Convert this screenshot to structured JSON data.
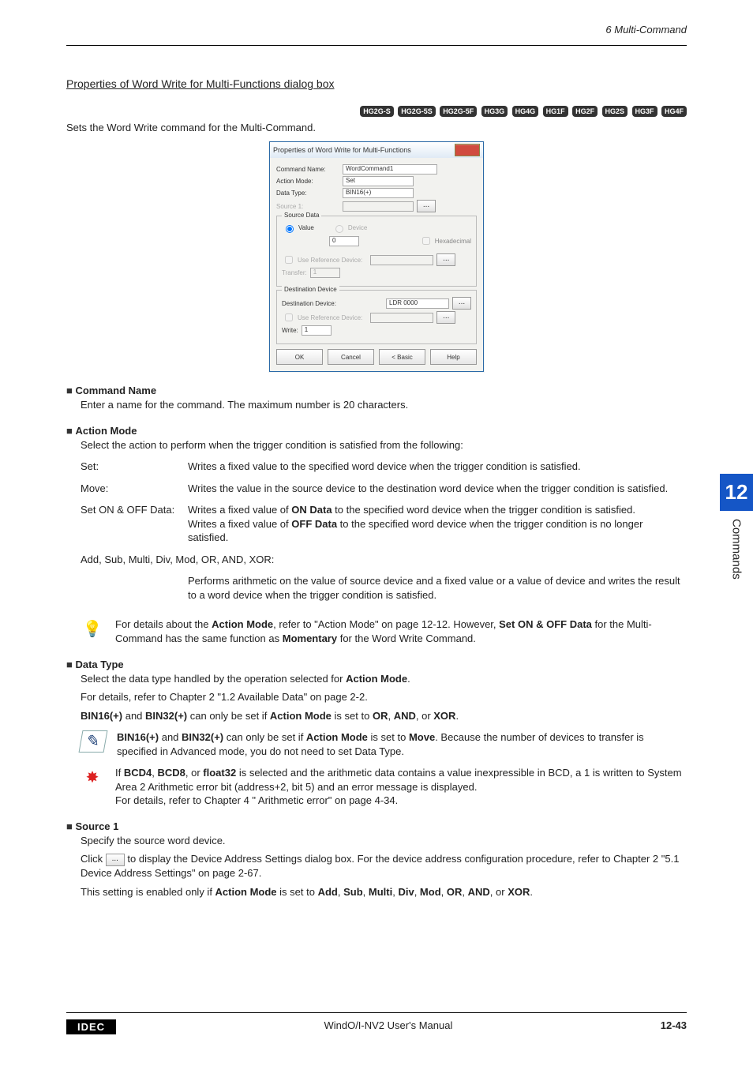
{
  "header": {
    "right": "6 Multi-Command"
  },
  "section_title": "Properties of Word Write for Multi-Functions dialog box",
  "pills": [
    "HG2G-S",
    "HG2G-5S",
    "HG2G-5F",
    "HG3G",
    "HG4G",
    "HG1F",
    "HG2F",
    "HG2S",
    "HG3F",
    "HG4F"
  ],
  "intro": "Sets the Word Write command for the Multi-Command.",
  "dlg": {
    "title": "Properties of Word Write for Multi-Functions",
    "close": "x",
    "fields": {
      "command_name_label": "Command Name:",
      "command_name_value": "WordCommand1",
      "action_mode_label": "Action Mode:",
      "action_mode_value": "Set",
      "data_type_label": "Data Type:",
      "data_type_value": "BIN16(+)",
      "source1_label": "Source 1:"
    },
    "src_group_title": "Source Data",
    "src": {
      "value_radio": "Value",
      "device_radio": "Device",
      "value": "0",
      "hex_label": "Hexadecimal",
      "use_ref_label": "Use Reference Device:",
      "transfer_label": "Transfer:",
      "transfer_value": "1"
    },
    "dst_group_title": "Destination Device",
    "dst": {
      "dest_label": "Destination Device:",
      "dest_value": "LDR 0000",
      "use_ref_label": "Use Reference Device:",
      "write_label": "Write:",
      "write_value": "1"
    },
    "buttons": {
      "ok": "OK",
      "cancel": "Cancel",
      "basic": "< Basic",
      "help": "Help"
    }
  },
  "cmdname_heading": "Command Name",
  "cmdname_body": "Enter a name for the command. The maximum number is 20 characters.",
  "actionmode_heading": "Action Mode",
  "actionmode_body": "Select the action to perform when the trigger condition is satisfied from the following:",
  "modes": {
    "set_k": "Set:",
    "set_v": "Writes a fixed value to the specified word device when the trigger condition is satisfied.",
    "move_k": "Move:",
    "move_v": "Writes the value in the source device to the destination word device when the trigger condition is satisfied.",
    "onoff_k": "Set ON & OFF Data:",
    "onoff_v1a": "Writes a fixed value of ",
    "onoff_v1b": "ON Data",
    "onoff_v1c": " to the specified word device when the trigger condition is satisfied.",
    "onoff_v2a": "Writes a fixed value of ",
    "onoff_v2b": "OFF Data",
    "onoff_v2c": " to the specified word device when the trigger condition is no longer satisfied.",
    "arith_k": "Add, Sub, Multi, Div, Mod, OR, AND, XOR:",
    "arith_v": "Performs arithmetic on the value of source device and a fixed value or a value of device and writes the result to a word device when the trigger condition is satisfied."
  },
  "bulb_note_a": "For details about the ",
  "bulb_note_b": "Action Mode",
  "bulb_note_c": ", refer to \"Action Mode\" on page 12-12. However, ",
  "bulb_note_d": "Set ON & OFF Data",
  "bulb_note_e": " for the Multi-Command has the same function as ",
  "bulb_note_f": "Momentary",
  "bulb_note_g": " for the Word Write Command.",
  "datatype_heading": "Data Type",
  "datatype_line1a": "Select the data type handled by the operation selected for ",
  "datatype_line1b": "Action Mode",
  "datatype_line1c": ".",
  "datatype_line2": "For details, refer to Chapter 2 \"1.2 Available Data\" on page 2-2.",
  "datatype_line3_parts": {
    "a": "BIN16(+)",
    "b": " and ",
    "c": "BIN32(+)",
    "d": " can only be set if ",
    "e": "Action Mode",
    "f": " is set to ",
    "g": "OR",
    "h": ", ",
    "i": "AND",
    "j": ", or ",
    "k": "XOR",
    "l": "."
  },
  "pencil_note": {
    "a": "BIN16(+)",
    "b": " and ",
    "c": "BIN32(+)",
    "d": " can only be set if ",
    "e": "Action Mode",
    "f": " is set to ",
    "g": "Move",
    "h": ". Because the number of devices to transfer is specified in Advanced mode, you do not need to set Data Type."
  },
  "warn_note": {
    "a": "If ",
    "b": "BCD4",
    "c": ", ",
    "d": "BCD8",
    "e": ", or ",
    "f": "float32",
    "g": " is selected and the arithmetic data contains a value inexpressible in BCD, a 1 is written to System Area 2 Arithmetic error bit (address+2, bit 5) and an error message is displayed.",
    "h": "For details, refer to Chapter 4 \" Arithmetic error\" on page 4-34."
  },
  "source1_heading": "Source 1",
  "source1_body": "Specify the source word device.",
  "source1_click_a": "Click ",
  "source1_click_btn": "...",
  "source1_click_b": " to display the Device Address Settings dialog box. For the device address configuration procedure, refer to Chapter 2 \"5.1 Device Address Settings\" on page 2-67.",
  "source1_enable": {
    "a": "This setting is enabled only if ",
    "b": "Action Mode",
    "c": " is set to ",
    "d": "Add",
    "e": ", ",
    "f": "Sub",
    "g": ", ",
    "h": "Multi",
    "i": ", ",
    "j": "Div",
    "k": ", ",
    "l": "Mod",
    "m": ", ",
    "n": "OR",
    "o": ", ",
    "p": "AND",
    "q": ", or ",
    "r": "XOR",
    "s": "."
  },
  "side": {
    "num": "12",
    "label": "Commands"
  },
  "footer": {
    "idec": "IDEC",
    "center": "WindO/I-NV2 User's Manual",
    "page": "12-43"
  }
}
